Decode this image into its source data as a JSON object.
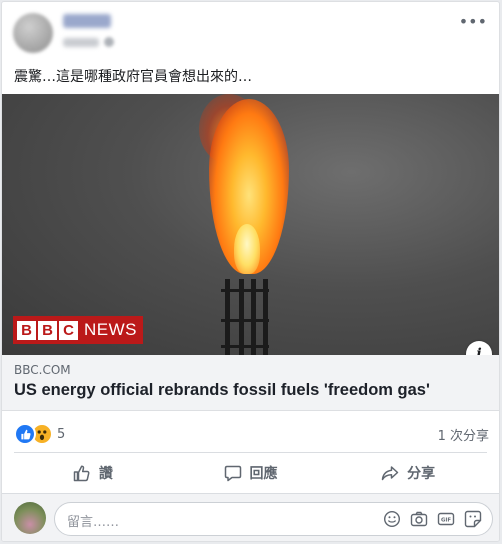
{
  "post": {
    "text": "震驚…這是哪種政府官員會想出來的…",
    "more_label": "•••"
  },
  "link": {
    "brand_letters": [
      "B",
      "B",
      "C"
    ],
    "brand_news": "NEWS",
    "domain": "BBC.COM",
    "title": "US energy official rebrands fossil fuels 'freedom gas'",
    "info_label": "i"
  },
  "reactions": {
    "count": "5",
    "types": [
      "like-icon",
      "wow-icon"
    ],
    "shares": "1 次分享"
  },
  "actions": {
    "like": "讚",
    "comment": "回應",
    "share": "分享"
  },
  "comment": {
    "placeholder": "留言……",
    "icons": [
      "emoji-icon",
      "camera-icon",
      "gif-icon",
      "sticker-icon"
    ]
  },
  "colors": {
    "like_blue": "#2078f4",
    "wow_yellow": "#f7b125",
    "bbc_red": "#bb1919",
    "text_gray": "#606770"
  }
}
